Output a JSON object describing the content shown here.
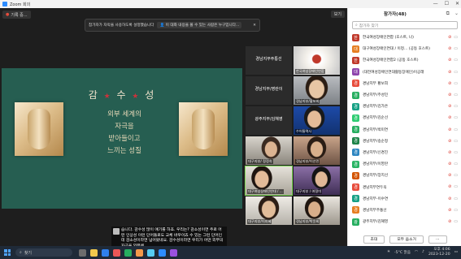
{
  "window": {
    "title": "Zoom 회의",
    "minimize": "—",
    "maximize": "☐",
    "close": "✕"
  },
  "toolbar": {
    "record_label": "기록 중...",
    "view_label": "보기"
  },
  "notice": {
    "text": "참가자가 자막을 사용하도록 설정했습니다",
    "pill": "이 대화 내용을 볼 수 있는 사람은 누구입니다...",
    "close": "✕"
  },
  "slide": {
    "title_left": "감",
    "title_mid": "수",
    "title_right": "성",
    "star": "★",
    "lines": [
      "외부 세계의",
      "자극을",
      "받아들이고",
      "느끼는 성질"
    ]
  },
  "tiles": [
    {
      "name": "경남지부주통선",
      "center": "경남지부주통선"
    },
    {
      "name": "한국여성장애인연합",
      "center": ""
    },
    {
      "name": "경남지부/영란이",
      "center": "경남지부/영란이"
    },
    {
      "name": "경남지부/황보희",
      "center": ""
    },
    {
      "name": "광주지부/김혜영",
      "center": "광주지부/김혜영"
    },
    {
      "name": "수어통역사",
      "center": ""
    },
    {
      "name": "대구지부/ 정정숙",
      "center": ""
    },
    {
      "name": "경남지부/이선민",
      "center": ""
    },
    {
      "name": "대구여성장애인연대 / ...",
      "center": ""
    },
    {
      "name": "대구지부 / 여정미",
      "center": ""
    },
    {
      "name": "대구지부/이지혜",
      "center": ""
    },
    {
      "name": "경남지부/박윤회",
      "center": ""
    }
  ],
  "caption": {
    "text": "습니다. 감수성 많이 얘기를 하죠. 우리는? 감소성이면 주로 어떤 인상성 이런 단어들로도 교체 바우이죠 수 있는 그런 단어인데 감소성이라면 넘어왔네요. 감수성이라면 우리가 어떤 외부의 자극을 외부에"
  },
  "participants": {
    "header": "참가자(48)",
    "search_placeholder": "참가자 찾기",
    "rows": [
      {
        "name": "한국여성장애인연합 (호스트, 나)",
        "initial": "한",
        "color": "#c0392b"
      },
      {
        "name": "대구여성장애인연대 / 이정... (공동 호스트)",
        "initial": "대",
        "color": "#e67e22"
      },
      {
        "name": "한국여성장애인연합2 (공동 호스트)",
        "initial": "한",
        "color": "#c0392b"
      },
      {
        "name": "(대전여성장애인연대활동장애인)이공래",
        "initial": "대",
        "color": "#8e44ad"
      },
      {
        "name": "경남지부 황보희",
        "initial": "경",
        "color": "#e74c3c"
      },
      {
        "name": "경남지부/주성민",
        "initial": "경",
        "color": "#27ae60"
      },
      {
        "name": "경남지부/김가은",
        "initial": "경",
        "color": "#16a085"
      },
      {
        "name": "경남지부/김순선",
        "initial": "경",
        "color": "#2ecc71"
      },
      {
        "name": "경남지부/박미연",
        "initial": "경",
        "color": "#27ae60"
      },
      {
        "name": "경남지부/송순정",
        "initial": "경",
        "color": "#1e8449"
      },
      {
        "name": "경남지부/신경진",
        "initial": "경",
        "color": "#2e86c1"
      },
      {
        "name": "경남지부/이영란",
        "initial": "경",
        "color": "#28b463"
      },
      {
        "name": "경남지부/장지선",
        "initial": "경",
        "color": "#d35400"
      },
      {
        "name": "경남지부연두옥",
        "initial": "경",
        "color": "#e74c3c"
      },
      {
        "name": "경남지부-이수연",
        "initial": "경",
        "color": "#16a085"
      },
      {
        "name": "경남지부주통선",
        "initial": "경",
        "color": "#e67e22"
      },
      {
        "name": "광주지부/김혜영",
        "initial": "광",
        "color": "#27ae60"
      }
    ],
    "invite_label": "초대",
    "mute_all_label": "모두 음소거",
    "more_label": "..."
  },
  "taskbar": {
    "search_label": "찾기",
    "weather": "-5°C 맑음",
    "time": "오후 4:06",
    "date": "2023-12-20"
  }
}
